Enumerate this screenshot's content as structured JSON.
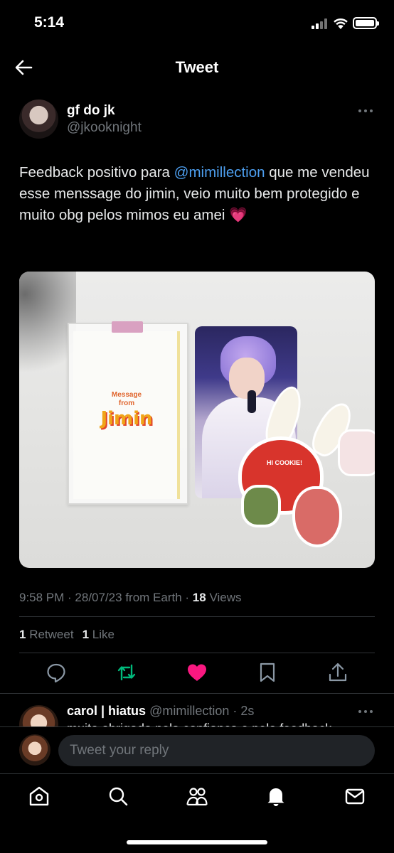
{
  "status_bar": {
    "time": "5:14"
  },
  "header": {
    "title": "Tweet"
  },
  "tweet": {
    "author_name": "gf do jk",
    "author_handle": "@jkooknight",
    "text_before": "Feedback positivo para ",
    "mention": "@mimillection",
    "text_after": " que me vendeu esse menssage do jimin, veio muito bem protegido e muito obg pelos mimos eu amei",
    "emoji": "💗",
    "media": {
      "card_line1": "Message",
      "card_line2": "from",
      "card_title": "Jimin",
      "sticker_text": "HI COOKIE!"
    },
    "timestamp": "9:58 PM · 28/07/23 from Earth ·",
    "views_count": "18",
    "views_label": "Views",
    "retweets_count": "1",
    "retweets_label": "Retweet",
    "likes_count": "1",
    "likes_label": "Like"
  },
  "reply": {
    "author_name": "carol | hiatus",
    "author_handle": "@mimillection · 2s",
    "text": "muito obrigada pela confiança e pelo feedback"
  },
  "composer": {
    "placeholder": "Tweet your reply"
  },
  "colors": {
    "accent": "#1d9bf0",
    "retweet_active": "#00ba7c",
    "like_active": "#f91880",
    "background": "#000000"
  },
  "icons": {
    "actions": [
      "reply-icon",
      "retweet-icon",
      "like-icon",
      "bookmark-icon",
      "share-icon"
    ],
    "tabs": [
      "home-icon",
      "search-icon",
      "communities-icon",
      "notifications-icon",
      "messages-icon"
    ]
  }
}
